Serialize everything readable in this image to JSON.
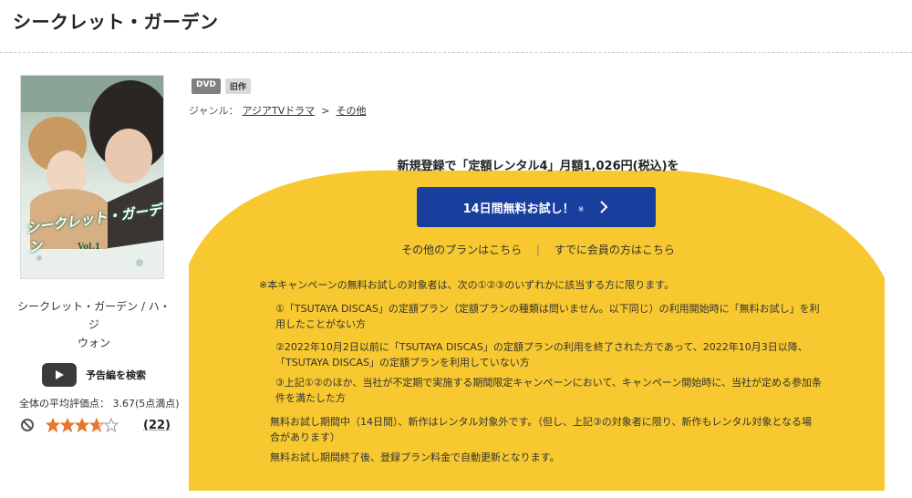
{
  "page": {
    "title": "シークレット・ガーデン"
  },
  "cover": {
    "title_art": "シークレット・ガーデン",
    "vol": "Vol.1"
  },
  "side": {
    "title_line1": "シークレット・ガーデン / ハ・ジ",
    "title_line2": "ウォン",
    "trailer_label": "予告編を検索",
    "avg_rating_text": "全体の平均評価点： 3.67(5点満点)",
    "rating_value": 3.67,
    "rating_max": 5,
    "review_count": "(22)"
  },
  "badges": {
    "dvd": "DVD",
    "old": "旧作"
  },
  "genre": {
    "label": "ジャンル：",
    "primary": "アジアTVドラマ",
    "separator": ">",
    "secondary": "その他"
  },
  "promo": {
    "headline": "新規登録で「定額レンタル4」月額1,026円(税込)を",
    "cta_label": "14日間無料お試し！",
    "cta_note": "※",
    "other_plans": "その他のプランはこちら",
    "divider": "|",
    "member_link": "すでに会員の方はこちら"
  },
  "notes": {
    "intro": "※本キャンペーンの無料お試しの対象者は、次の①②③のいずれかに該当する方に限ります。",
    "item1": "①「TSUTAYA DISCAS」の定額プラン（定額プランの種類は問いません。以下同じ）の利用開始時に「無料お試し」を利用したことがない方",
    "item2": "②2022年10月2日以前に「TSUTAYA DISCAS」の定額プランの利用を終了された方であって、2022年10月3日以降、「TSUTAYA DISCAS」の定額プランを利用していない方",
    "item3": "③上記①②のほか、当社が不定期で実施する期間限定キャンペーンにおいて、キャンペーン開始時に、当社が定める参加条件を満たした方",
    "item4": "無料お試し期間中（14日間）、新作はレンタル対象外です。（但し、上記③の対象者に限り、新作もレンタル対象となる場合があります）",
    "item5": "無料お試し期間終了後、登録プラン料金で自動更新となります。"
  },
  "colors": {
    "brand_yellow": "#f7c82f",
    "cta_blue": "#183f9e",
    "star_orange": "#e8762b"
  },
  "icons": {
    "trailer": "youtube-play-icon",
    "no_rating": "prohibited-icon",
    "cta_arrow": "chevron-right-icon"
  }
}
